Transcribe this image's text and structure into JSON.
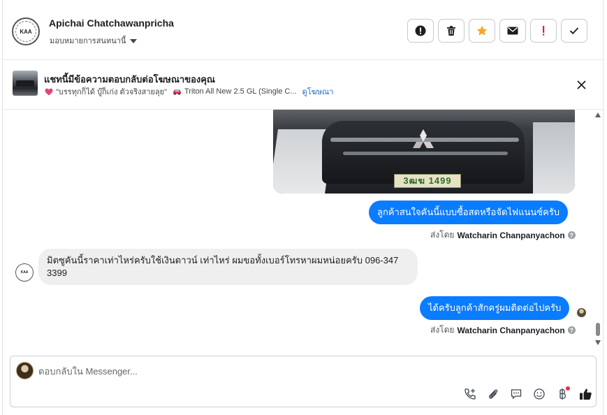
{
  "header": {
    "logo_text": "KAA",
    "name": "Apichai Chatchawanpricha",
    "assign_label": "มอบหมายการสนทนานี้",
    "actions": [
      {
        "name": "spam-button",
        "icon": "exclamation-circle-icon"
      },
      {
        "name": "delete-button",
        "icon": "trash-icon"
      },
      {
        "name": "star-button",
        "icon": "star-icon"
      },
      {
        "name": "mark-unread-button",
        "icon": "envelope-icon"
      },
      {
        "name": "follow-up-button",
        "icon": "exclamation-icon"
      },
      {
        "name": "done-button",
        "icon": "check-icon"
      }
    ],
    "colors": {
      "star": "#f5a623",
      "alert": "#e41e3f"
    }
  },
  "ad": {
    "title": "แชทนี้มีข้อความตอบกลับต่อโฆษณาของคุณ",
    "detail": "\"บรรทุกก็ได้ บู๊ก็เก่ง ตัวจริงสายลุย\"",
    "product": "Triton All New 2.5 GL (Single C...",
    "link": "ดูโฆษณา"
  },
  "messages": {
    "plate_text": "3ฒฆ 1499",
    "out1": "ลูกค้าสนใจคันนี้แบบซื้อสดหรือจัดไฟแนนซ์ครับ",
    "sent_by_prefix": "ส่งโดย",
    "sender": "Watcharin Chanpanyachon",
    "in1": "มิตซูคันนี้ราคาเท่าไหร่ครับใช้เงินดาวน์ เท่าไหร่ ผมขอทั้งเบอร์โทรหาผมหน่อยครับ 096-347 3399",
    "out2": "ได้ครับลูกค้าสักครู่ผมติดต่อไปครับ",
    "bubble_color": "#0a7cff"
  },
  "composer": {
    "placeholder": "ตอบกลับใน Messenger...",
    "tools": [
      "phone-plus-icon",
      "paperclip-icon",
      "saved-reply-icon",
      "emoji-icon",
      "baht-icon",
      "like-icon"
    ]
  }
}
